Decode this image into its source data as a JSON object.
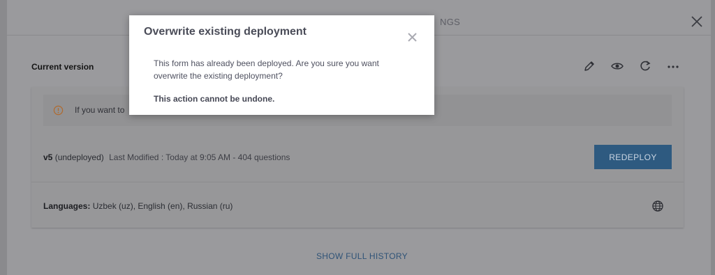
{
  "header": {
    "tab_label": "NGS"
  },
  "current_version": {
    "label": "Current version"
  },
  "toolbar": {
    "edit_icon": "pencil-icon",
    "preview_icon": "eye-icon",
    "refresh_icon": "refresh-icon",
    "more_icon": "more-icon"
  },
  "warning": {
    "text": "If you want to"
  },
  "version": {
    "number": "v5",
    "status": "(undeployed)",
    "modified": "Last Modified : Today at 9:05 AM - 404 questions",
    "redeploy_label": "REDEPLOY"
  },
  "languages": {
    "label": "Languages:",
    "value": "Uzbek (uz), English (en), Russian (ru)"
  },
  "history": {
    "label": "SHOW FULL HISTORY"
  },
  "modal": {
    "title": "Overwrite existing deployment",
    "body": "This form has already been deployed. Are you sure you want overwrite the existing deployment?",
    "warning": "This action cannot be undone."
  },
  "colors": {
    "accent": "#2e5a80",
    "link": "#2f5377",
    "warning_icon": "#b06a2e"
  }
}
